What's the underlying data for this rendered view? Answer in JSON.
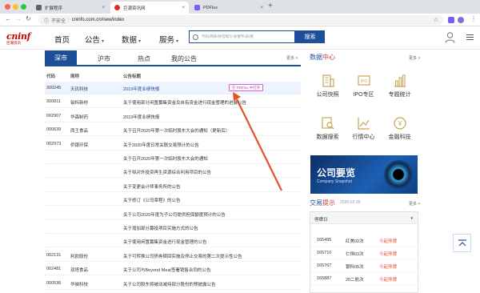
{
  "browser": {
    "tabs": [
      {
        "label": "扩展程序",
        "color": "#5f6368"
      },
      {
        "label": "巨潮资讯网",
        "color": "#d93025"
      },
      {
        "label": "PDFlux",
        "color": "#7b5cff"
      }
    ],
    "insecure_label": "不安全",
    "url": "cninfo.com.cn/new/index"
  },
  "header": {
    "logo_text": "cninf",
    "logo_sub": "巨潮资讯",
    "nav": [
      "首页",
      "公告",
      "数据",
      "服务"
    ],
    "search_placeholder": "代码/简称/拼音缩写/关键字/表/要",
    "search_button": "搜索"
  },
  "main": {
    "tabs": [
      "深市",
      "沪市",
      "热点",
      "我的公告"
    ],
    "more": "更多 >",
    "columns": [
      "代码",
      "简称",
      "公告标题"
    ],
    "pdf_badge": "在 PDFlux 中打开",
    "rows": [
      {
        "code": "300245",
        "name": "天玑科技",
        "title": "2019年度业绩快报"
      },
      {
        "code": "300811",
        "name": "铂科新材",
        "title": "关于使用部分闲置募集资金及自有资金进行现金管理的进展公告"
      },
      {
        "code": "002907",
        "name": "华森制药",
        "title": "2019年度业绩快报"
      },
      {
        "code": "000639",
        "name": "西王食品",
        "title": "关于召开2020年第一次临时股东大会的通知（更新后）"
      },
      {
        "code": "002973",
        "name": "侨银环保",
        "title": "关于2020年度日常关联交易预计的公告"
      },
      {
        "code": "",
        "name": "",
        "title": "关于召开2020年第一次临时股东大会的通知"
      },
      {
        "code": "",
        "name": "",
        "title": "关于拟对外投资再生资源综合利用项目的公告"
      },
      {
        "code": "",
        "name": "",
        "title": "关于变更会计师事务所的公告"
      },
      {
        "code": "",
        "name": "",
        "title": "关于修订《公司章程》的公告"
      },
      {
        "code": "",
        "name": "",
        "title": "关于公司2020年度为子公司提供担保额度预计的公告"
      },
      {
        "code": "",
        "name": "",
        "title": "关于增加部分募投项目实施方式的公告"
      },
      {
        "code": "",
        "name": "",
        "title": "关于使用闲置募集资金进行现金管理的公告"
      },
      {
        "code": "002131",
        "name": "利欧股份",
        "title": "关于可转换公司债券赎回实施及停止交易的第二次提示性公告"
      },
      {
        "code": "002481",
        "name": "双塔食品",
        "title": "关于公司与Beyond Meat签署销售合同的公告"
      },
      {
        "code": "000536",
        "name": "华映科技",
        "title": "关于公司股东将被动减持部分股份的预披露公告"
      }
    ]
  },
  "data_center": {
    "title_a": "数据",
    "title_b": "中心",
    "items": [
      {
        "label": "公司快照",
        "icon": "building-icon"
      },
      {
        "label": "IPO专区",
        "icon": "ipo-icon"
      },
      {
        "label": "专题统计",
        "icon": "bar-chart-icon"
      },
      {
        "label": "数据搜索",
        "icon": "data-search-icon"
      },
      {
        "label": "行情中心",
        "icon": "line-chart-icon"
      },
      {
        "label": "金融科技",
        "icon": "fintech-icon"
      }
    ],
    "banner_title": "公司要览",
    "banner_sub": "Company Snapshot"
  },
  "trading": {
    "title_a": "交易",
    "title_b": "提示",
    "date": "2020-02-25",
    "filter": "停牌日",
    "col_hint": "",
    "rows": [
      {
        "code": "165495",
        "name": "红美02次",
        "action": "今起停牌"
      },
      {
        "code": "165710",
        "name": "仁恒03次",
        "action": "今起停牌"
      },
      {
        "code": "165767",
        "name": "银科05次",
        "action": "今起停牌"
      },
      {
        "code": "165887",
        "name": "20二航次",
        "action": "今起停牌"
      }
    ]
  },
  "colors": {
    "brand": "#1f4e99",
    "accent": "#c33",
    "annotation_arrow": "#e0542c"
  }
}
